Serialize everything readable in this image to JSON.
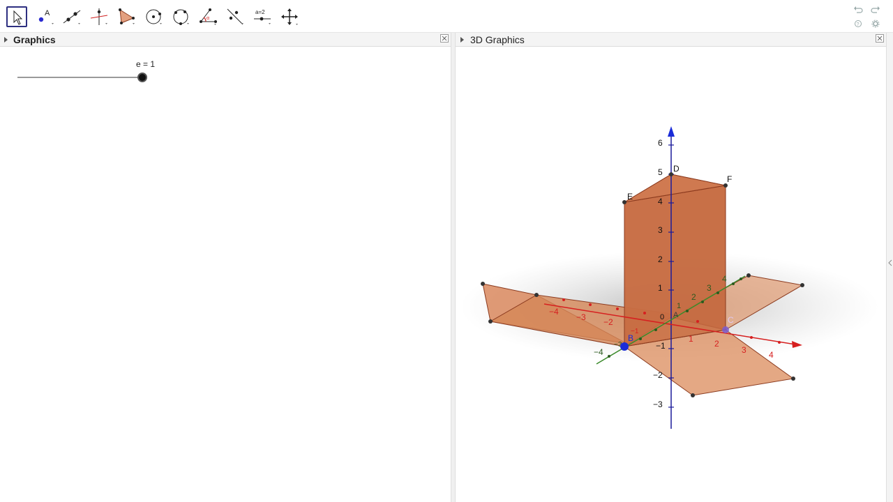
{
  "toolbar": {
    "tools": [
      {
        "name": "move-tool",
        "selected": true
      },
      {
        "name": "point-tool"
      },
      {
        "name": "line-tool"
      },
      {
        "name": "perpendicular-line-tool"
      },
      {
        "name": "polygon-tool"
      },
      {
        "name": "circle-tool"
      },
      {
        "name": "circle-three-points-tool"
      },
      {
        "name": "angle-tool"
      },
      {
        "name": "reflect-tool"
      },
      {
        "name": "slider-tool"
      },
      {
        "name": "move-graphics-view-tool"
      }
    ],
    "undo_icon": "undo-icon",
    "redo_icon": "redo-icon",
    "help_icon": "help-icon",
    "settings_icon": "gear-icon",
    "selected_color": "#2d2f80"
  },
  "graphics_panel": {
    "title": "Graphics",
    "slider": {
      "label": "e = 1",
      "value": 1
    }
  },
  "graphics3d_panel": {
    "title": "3D Graphics"
  },
  "scene": {
    "z_ticks": [
      "6",
      "5",
      "4",
      "3",
      "2",
      "1",
      "0",
      "−1",
      "−2",
      "−3"
    ],
    "x_ticks_neg": [
      "−4",
      "−3",
      "−2",
      "−1"
    ],
    "x_ticks_pos": [
      "1",
      "2",
      "3",
      "4"
    ],
    "y_ticks": [
      "−4",
      "−3",
      "1",
      "2",
      "3",
      "4"
    ],
    "points": [
      "B",
      "C",
      "D",
      "E",
      "F",
      "A"
    ],
    "colors": {
      "face": "#c8643c",
      "edge": "#8b3a1e",
      "x_axis": "#d62020",
      "y_axis": "#3a8a2a",
      "z_axis": "#1a1a9a",
      "point_blue": "#1a2cd8",
      "point_purple": "#7a5cd0"
    }
  }
}
